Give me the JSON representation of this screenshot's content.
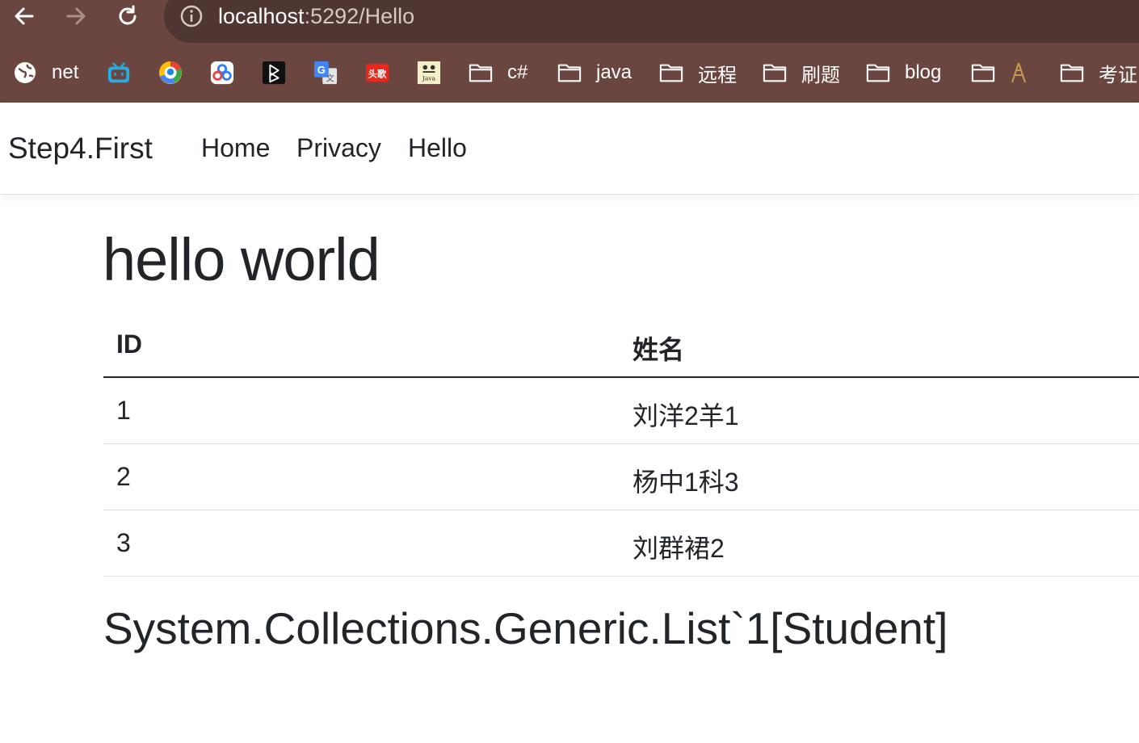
{
  "browser": {
    "url_host": "localhost",
    "url_path": ":5292/Hello",
    "bookmarks": [
      {
        "icon": "globe-icon",
        "label": "net"
      },
      {
        "icon": "bilibili-icon",
        "label": ""
      },
      {
        "icon": "bird-app-icon",
        "label": ""
      },
      {
        "icon": "cloud-drive-icon",
        "label": ""
      },
      {
        "icon": "play-app-icon",
        "label": ""
      },
      {
        "icon": "translate-icon",
        "label": ""
      },
      {
        "icon": "toutiao-icon",
        "label": ""
      },
      {
        "icon": "java-book-icon",
        "label": ""
      },
      {
        "icon": "folder-icon",
        "label": "c#"
      },
      {
        "icon": "folder-icon",
        "label": "java"
      },
      {
        "icon": "folder-icon",
        "label": "远程"
      },
      {
        "icon": "folder-icon",
        "label": "刷题"
      },
      {
        "icon": "folder-icon",
        "label": "blog"
      },
      {
        "icon": "folder-icon",
        "label": ""
      },
      {
        "icon": "folder-icon",
        "label": "考证"
      }
    ],
    "favicon_text": {
      "toutiao": "头歌",
      "java": "Java",
      "translate": "G"
    }
  },
  "navbar": {
    "brand": "Step4.First",
    "links": [
      "Home",
      "Privacy",
      "Hello"
    ]
  },
  "main": {
    "heading": "hello world",
    "table": {
      "headers": [
        "ID",
        "姓名"
      ],
      "rows": [
        [
          "1",
          "刘洋2羊1"
        ],
        [
          "2",
          "杨中1科3"
        ],
        [
          "3",
          "刘群裙2"
        ]
      ]
    },
    "subheading": "System.Collections.Generic.List`1[Student]"
  },
  "colors": {
    "chrome": "#6b4640",
    "urlbar": "#4f3632",
    "text": "#212529"
  }
}
